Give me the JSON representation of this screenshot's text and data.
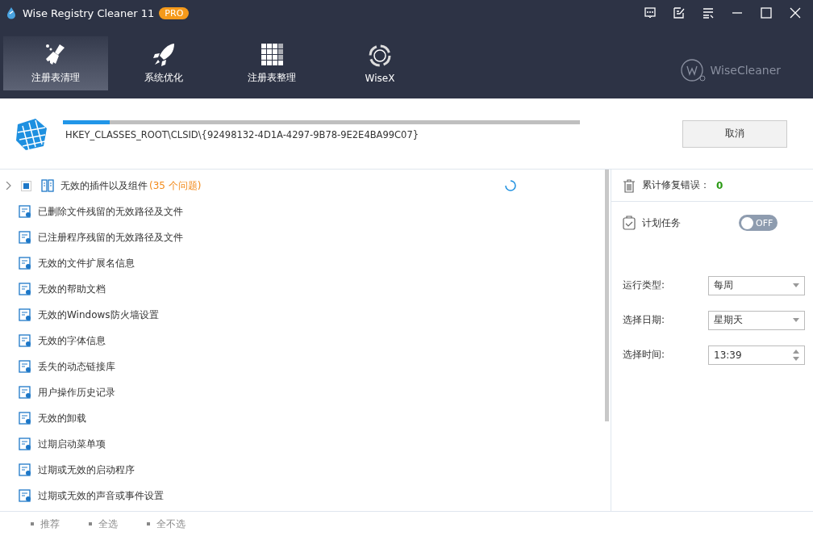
{
  "window": {
    "title": "Wise Registry Cleaner 11",
    "badge": "PRO"
  },
  "tabs": [
    {
      "label": "注册表清理",
      "selected": true,
      "kind": "broom"
    },
    {
      "label": "系统优化",
      "selected": false,
      "kind": "rocket"
    },
    {
      "label": "注册表整理",
      "selected": false,
      "kind": "grid"
    },
    {
      "label": "WiseX",
      "selected": false,
      "kind": "ai"
    }
  ],
  "brand": "WiseCleaner",
  "scan": {
    "level": 0.09,
    "path": "HKEY_CLASSES_ROOT\\CLSID\\{92498132-4D1A-4297-9B78-9E2E4BA99C07}",
    "cancel": "取消"
  },
  "categories": [
    {
      "kind": "group",
      "label": "无效的插件以及组件",
      "count": "(35 个问题)",
      "expanded": false,
      "checked": true,
      "scanning": true
    },
    {
      "kind": "item",
      "label": "已删除文件残留的无效路径及文件"
    },
    {
      "kind": "item",
      "label": "已注册程序残留的无效路径及文件"
    },
    {
      "kind": "item",
      "label": "无效的文件扩展名信息"
    },
    {
      "kind": "item",
      "label": "无效的帮助文档"
    },
    {
      "kind": "item",
      "label": "无效的Windows防火墙设置"
    },
    {
      "kind": "item",
      "label": "无效的字体信息"
    },
    {
      "kind": "item",
      "label": "丢失的动态链接库"
    },
    {
      "kind": "item",
      "label": "用户操作历史记录"
    },
    {
      "kind": "item",
      "label": "无效的卸载"
    },
    {
      "kind": "item",
      "label": "过期启动菜单项"
    },
    {
      "kind": "item",
      "label": "过期或无效的启动程序"
    },
    {
      "kind": "item",
      "label": "过期或无效的声音或事件设置"
    }
  ],
  "side": {
    "fixed_label": "累计修复错误：",
    "fixed_count": "0",
    "schedule_label": "计划任务",
    "schedule_on": false,
    "toggle_text": "OFF",
    "fields": [
      {
        "kind": "select",
        "label": "运行类型:",
        "value": "每周"
      },
      {
        "kind": "select",
        "label": "选择日期:",
        "value": "星期天"
      },
      {
        "kind": "spin",
        "label": "选择时间:",
        "value": "13:39"
      }
    ]
  },
  "footer": [
    "推荐",
    "全选",
    "全不选"
  ]
}
